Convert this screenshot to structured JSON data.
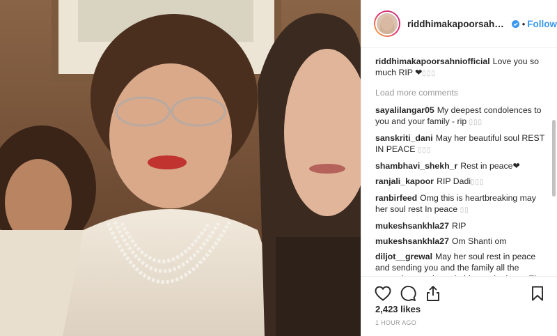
{
  "post": {
    "username": "riddhimakapoorsahnioff...",
    "dot": "•",
    "follow_label": "Follow",
    "caption_user": "riddhimakapoorsahniofficial",
    "caption_text": "Love you so much RIP ❤",
    "caption_emoji": "▯▯▯",
    "load_more": "Load more comments",
    "likes": "2,423 likes",
    "time": "1 HOUR AGO"
  },
  "comments": [
    {
      "user": "sayalilangar05",
      "text": "My deepest condolences to you and your family - rip",
      "emoji": "▯▯▯"
    },
    {
      "user": "sanskriti_dani",
      "text": "May her beautiful soul REST IN PEACE",
      "emoji": "▯▯▯"
    },
    {
      "user": "shambhavi_shekh_r",
      "text": "Rest in peace❤",
      "emoji": ""
    },
    {
      "user": "ranjali_kapoor",
      "text": "RIP Dadi",
      "emoji": "▯▯▯"
    },
    {
      "user": "ranbirfeed",
      "text": "Omg this is heartbreaking may her soul rest In peace",
      "emoji": "▯▯"
    },
    {
      "user": "mukeshsankhla27",
      "text": "RIP",
      "emoji": ""
    },
    {
      "user": "mukeshsankhla27",
      "text": "Om Shanti om",
      "emoji": ""
    },
    {
      "user": "diljot__grewal",
      "text": "May her soul rest in peace and sending you and the family all the strength to go through this tough phase. The pain of losing a loved one is the worst, but they'll always be with you in memories.",
      "emoji": ""
    }
  ],
  "colors": {
    "accent": "#3897f0",
    "text": "#262626",
    "muted": "#999999",
    "border": "#efefef"
  },
  "icons": {
    "verified": "verified-badge-icon",
    "like": "heart-icon",
    "comment": "comment-bubble-icon",
    "share": "share-icon",
    "save": "bookmark-icon"
  }
}
